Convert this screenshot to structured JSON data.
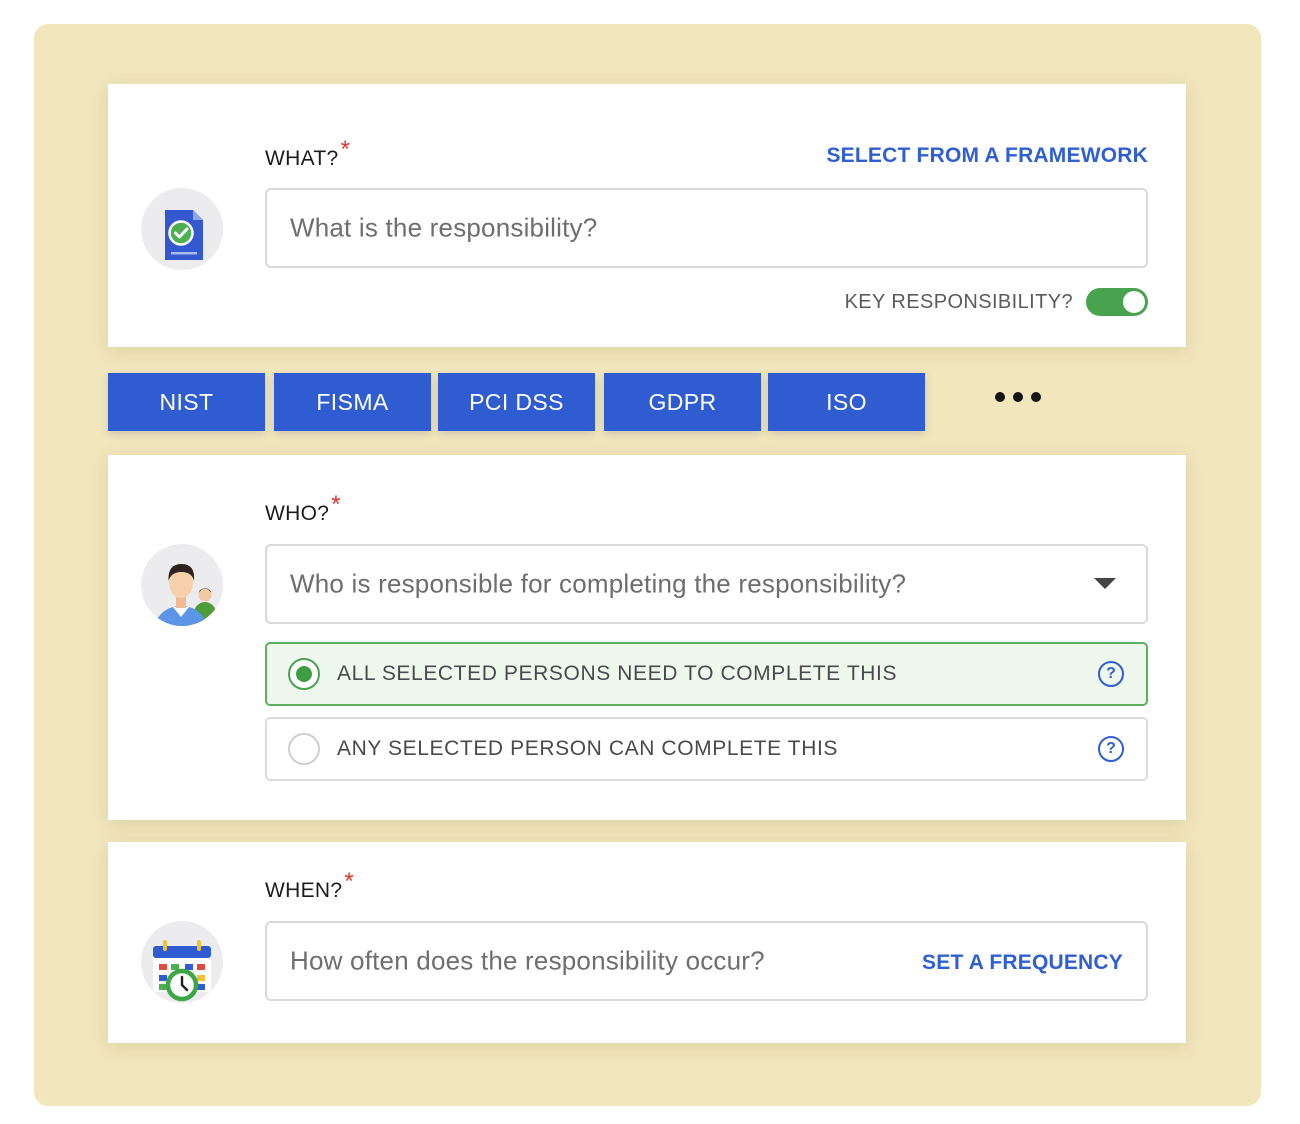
{
  "what": {
    "label": "WHAT?",
    "required_mark": "*",
    "framework_link": "SELECT FROM A FRAMEWORK",
    "input_placeholder": "What is the responsibility?",
    "key_responsibility_label": "KEY RESPONSIBILITY?",
    "key_responsibility_on": true,
    "icon": "document-check-icon"
  },
  "frameworks": {
    "tags": [
      "NIST",
      "FISMA",
      "PCI DSS",
      "GDPR",
      "ISO"
    ],
    "more_icon": "more-horizontal-icon"
  },
  "who": {
    "label": "WHO?",
    "required_mark": "*",
    "select_placeholder": "Who is responsible for completing the responsibility?",
    "options": [
      {
        "label": "ALL SELECTED PERSONS NEED TO COMPLETE THIS",
        "selected": true
      },
      {
        "label": "ANY SELECTED PERSON CAN COMPLETE THIS",
        "selected": false
      }
    ],
    "help_glyph": "?",
    "icon": "people-icon"
  },
  "when": {
    "label": "WHEN?",
    "required_mark": "*",
    "input_placeholder": "How often does the responsibility occur?",
    "frequency_link": "SET A FREQUENCY",
    "icon": "calendar-clock-icon"
  },
  "colors": {
    "backdrop": "#f2e6bc",
    "accent_blue": "#2f5cd0",
    "toggle_green": "#49a24d",
    "required_red": "#e2342b"
  }
}
